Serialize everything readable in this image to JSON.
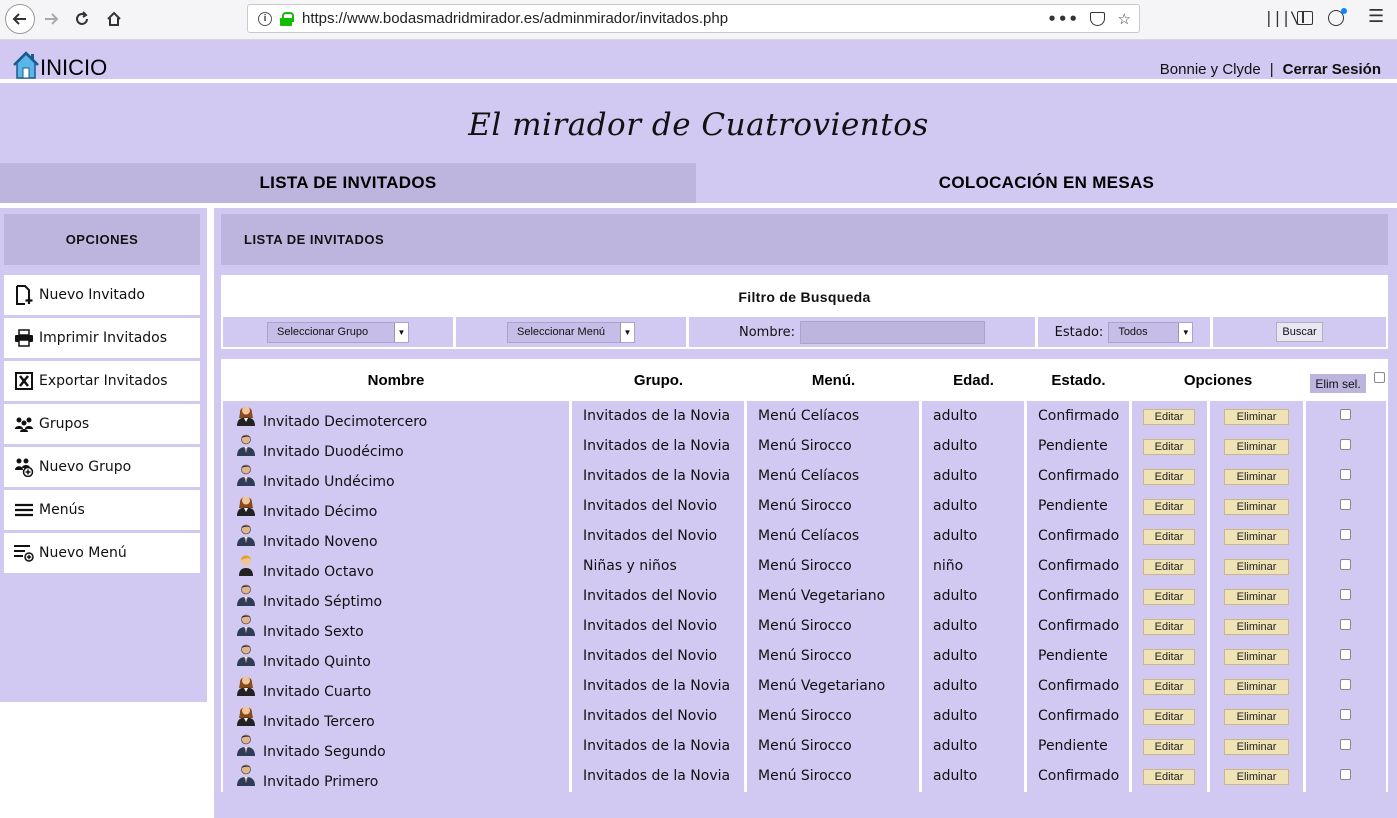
{
  "browser": {
    "url": "https://www.bodasmadridmirador.es/adminmirador/invitados.php"
  },
  "header": {
    "home_label": "INICIO",
    "user_name": "Bonnie y Clyde",
    "separator": "|",
    "logout_label": "Cerrar Sesión",
    "site_title": "El mirador de Cuatrovientos"
  },
  "tabs": [
    {
      "label": "LISTA DE INVITADOS",
      "active": true
    },
    {
      "label": "COLOCACIÓN EN MESAS",
      "active": false
    }
  ],
  "sidebar": {
    "title": "OPCIONES",
    "items": [
      {
        "label": "Nuevo Invitado",
        "icon": "add-document-icon"
      },
      {
        "label": "Imprimir Invitados",
        "icon": "printer-icon"
      },
      {
        "label": "Exportar Invitados",
        "icon": "excel-icon"
      },
      {
        "label": "Grupos",
        "icon": "group-icon"
      },
      {
        "label": "Nuevo Grupo",
        "icon": "add-group-icon"
      },
      {
        "label": "Menús",
        "icon": "menu-lines-icon"
      },
      {
        "label": "Nuevo Menú",
        "icon": "add-menu-icon"
      }
    ]
  },
  "main": {
    "title": "LISTA DE INVITADOS",
    "filter": {
      "title": "Filtro de Busqueda",
      "group_select": "Seleccionar Grupo",
      "menu_select": "Seleccionar Menú",
      "name_label": "Nombre:",
      "name_value": "",
      "state_label": "Estado:",
      "state_select": "Todos",
      "search_button": "Buscar"
    },
    "table": {
      "headers": [
        "Nombre",
        "Grupo.",
        "Menú.",
        "Edad.",
        "Estado.",
        "Opciones"
      ],
      "delete_selected": "Elim sel.",
      "edit_label": "Editar",
      "delete_label": "Eliminar",
      "rows": [
        {
          "name": "Invitado Decimotercero",
          "gender": "female",
          "group": "Invitados de la Novia",
          "menu": "Menú Celíacos",
          "age": "adulto",
          "state": "Confirmado"
        },
        {
          "name": "Invitado Duodécimo",
          "gender": "male",
          "group": "Invitados de la Novia",
          "menu": "Menú Sirocco",
          "age": "adulto",
          "state": "Pendiente"
        },
        {
          "name": "Invitado Undécimo",
          "gender": "male",
          "group": "Invitados de la Novia",
          "menu": "Menú Celíacos",
          "age": "adulto",
          "state": "Confirmado"
        },
        {
          "name": "Invitado Décimo",
          "gender": "female",
          "group": "Invitados del Novio",
          "menu": "Menú Sirocco",
          "age": "adulto",
          "state": "Pendiente"
        },
        {
          "name": "Invitado Noveno",
          "gender": "male",
          "group": "Invitados del Novio",
          "menu": "Menú Celíacos",
          "age": "adulto",
          "state": "Confirmado"
        },
        {
          "name": "Invitado Octavo",
          "gender": "child",
          "group": "Niñas y niños",
          "menu": "Menú Sirocco",
          "age": "niño",
          "state": "Confirmado"
        },
        {
          "name": "Invitado Séptimo",
          "gender": "male",
          "group": "Invitados del Novio",
          "menu": "Menú Vegetariano",
          "age": "adulto",
          "state": "Confirmado"
        },
        {
          "name": "Invitado Sexto",
          "gender": "male",
          "group": "Invitados del Novio",
          "menu": "Menú Sirocco",
          "age": "adulto",
          "state": "Confirmado"
        },
        {
          "name": "Invitado Quinto",
          "gender": "male",
          "group": "Invitados del Novio",
          "menu": "Menú Sirocco",
          "age": "adulto",
          "state": "Pendiente"
        },
        {
          "name": "Invitado Cuarto",
          "gender": "female",
          "group": "Invitados de la Novia",
          "menu": "Menú Vegetariano",
          "age": "adulto",
          "state": "Confirmado"
        },
        {
          "name": "Invitado Tercero",
          "gender": "female",
          "group": "Invitados del Novio",
          "menu": "Menú Sirocco",
          "age": "adulto",
          "state": "Confirmado"
        },
        {
          "name": "Invitado Segundo",
          "gender": "male",
          "group": "Invitados de la Novia",
          "menu": "Menú Sirocco",
          "age": "adulto",
          "state": "Pendiente"
        },
        {
          "name": "Invitado Primero",
          "gender": "male",
          "group": "Invitados de la Novia",
          "menu": "Menú Sirocco",
          "age": "adulto",
          "state": "Confirmado"
        }
      ]
    }
  },
  "colors": {
    "lavender": "#d2c9f2",
    "lavender_dark": "#bdb5de",
    "button_beige": "#efe2b4"
  }
}
